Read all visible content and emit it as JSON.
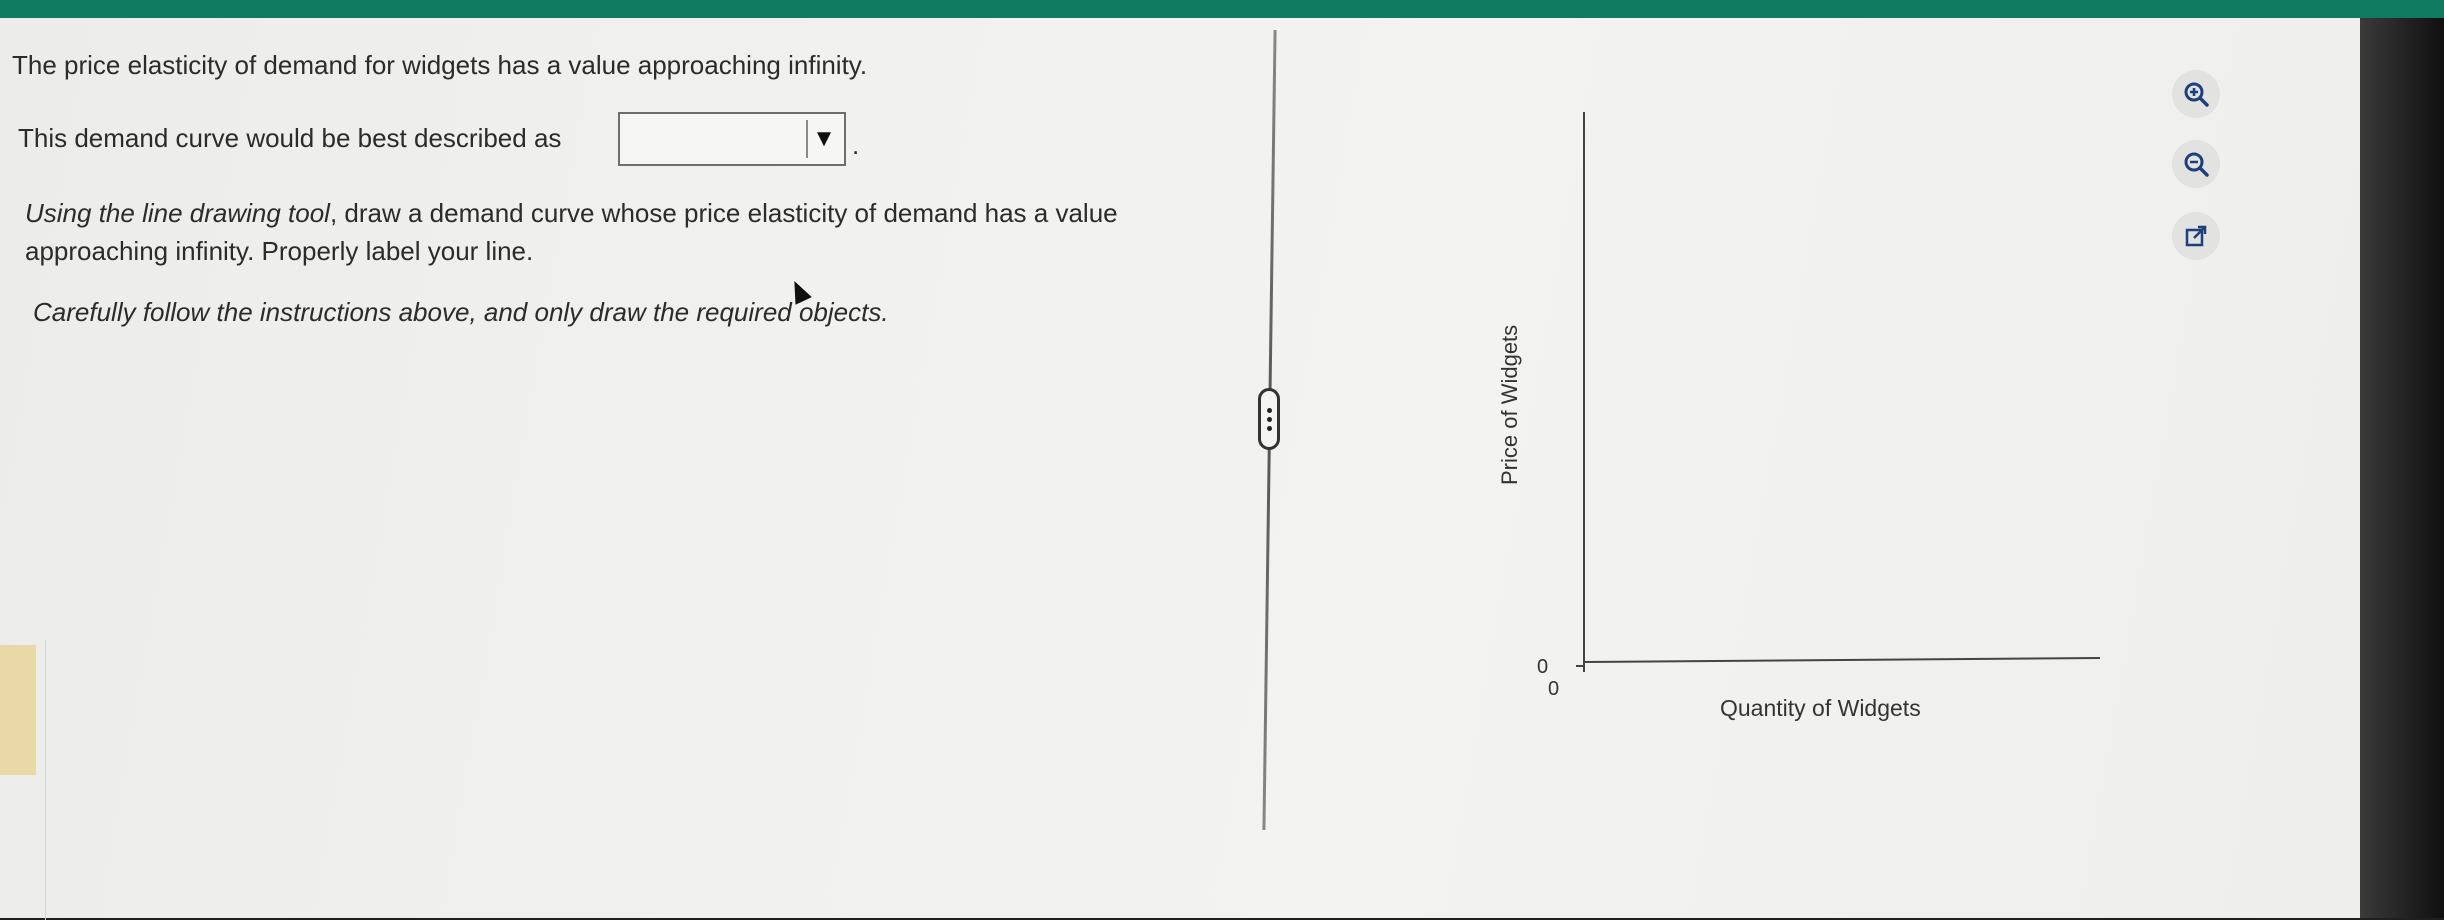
{
  "question": {
    "line1": "The price elasticity of demand for widgets has a value approaching infinity.",
    "line2_prefix": "This demand curve would be best described as",
    "dropdown_value": "",
    "dropdown_arrow": "▼",
    "period": ".",
    "instruction_lead": "Using the line drawing tool",
    "instruction_rest": ", draw a demand curve whose price elasticity of demand has a value approaching infinity. Properly label your line.",
    "caution": "Carefully follow the instructions above, and only draw the required objects."
  },
  "graph": {
    "y_axis_label": "Price of Widgets",
    "x_axis_label": "Quantity of Widgets",
    "y_origin_tick": "0",
    "x_origin_tick": "0"
  },
  "tools": {
    "zoom_in": "zoom-in-icon",
    "zoom_out": "zoom-out-icon",
    "popout": "external-link-icon"
  },
  "colors": {
    "top_bar": "#0f7a60",
    "background": "#f1f1ef",
    "tool_icon": "#1f3f7a"
  }
}
